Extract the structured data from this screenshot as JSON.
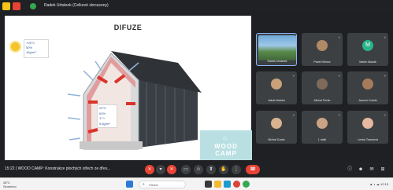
{
  "window": {
    "title": "Radek Urbánek (Celkové zkrouceny)"
  },
  "slide": {
    "title": "DIFUZE",
    "outside_climate": [
      "+25°C",
      "50%",
      "16g/m³"
    ],
    "inside_climate": [
      "20°C",
      "60%",
      "17 t",
      "5,6g/m³"
    ],
    "brand": [
      "WOOD",
      "CAMP"
    ]
  },
  "participants": [
    {
      "name": "Radek Urbánek",
      "type": "video",
      "active": true
    },
    {
      "name": "Pavel Němec",
      "type": "avatar",
      "color": "#b08a64"
    },
    {
      "name": "Martin Mazák",
      "type": "letter",
      "letter": "M",
      "color": "#2bb48a"
    },
    {
      "name": "Jakub Walder",
      "type": "avatar",
      "color": "#c9a27a"
    },
    {
      "name": "Michal Pertin",
      "type": "avatar",
      "color": "#7f6a5a"
    },
    {
      "name": "Jaromír Kubrle",
      "type": "avatar",
      "color": "#a47c5b"
    },
    {
      "name": "Michal Gurek",
      "type": "avatar",
      "color": "#d9b28f"
    },
    {
      "name": "1 další",
      "type": "avatar",
      "color": "#caa284"
    },
    {
      "name": "Lenka Trandová",
      "type": "avatar",
      "color": "#e4b9a0"
    }
  ],
  "meeting": {
    "time_title": "15:22 | WOOD CAMP: Konstrukce plochých střech ze dřev..."
  },
  "taskbar": {
    "weather": [
      "28°C",
      "Slunečno"
    ],
    "search_placeholder": "Hledat",
    "tray": "▲ ◐ ☁ 12:15"
  },
  "colors": {
    "accent_red": "#ea4335",
    "tile_bg": "#3c4043",
    "brand_teal": "#b9dfe2"
  }
}
